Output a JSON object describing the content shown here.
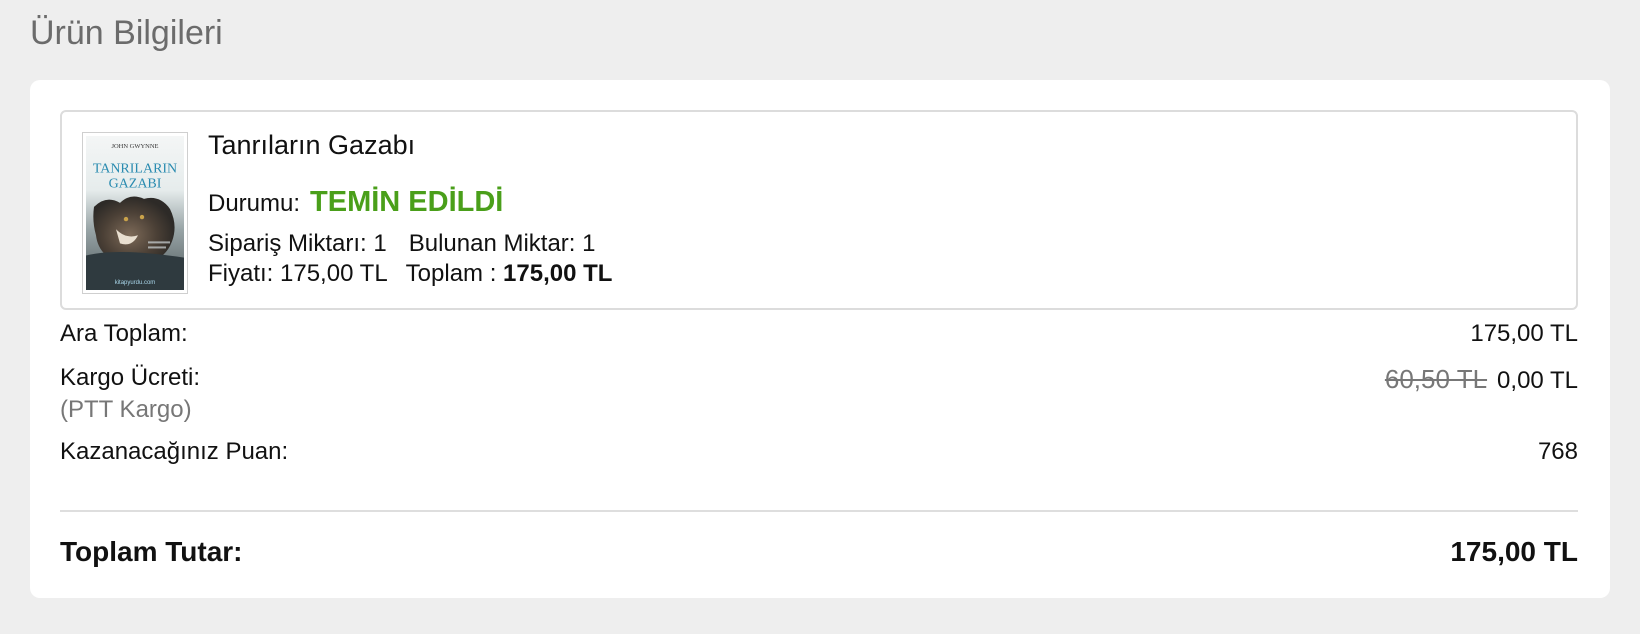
{
  "section_title": "Ürün Bilgileri",
  "product": {
    "name": "Tanrıların Gazabı",
    "cover": {
      "author": "JOHN GWYNNE",
      "title_line1": "TANRILARIN",
      "title_line2": "GAZABI",
      "publisher": "kitapyurdu.com"
    },
    "status_label": "Durumu:",
    "status_value": "TEMİN EDİLDİ",
    "status_color": "#4a9f1a",
    "order_qty_label": "Sipariş Miktarı: 1",
    "found_qty_label": "Bulunan Miktar: 1",
    "price_label": "Fiyatı: 175,00 TL",
    "total_label": "Toplam :",
    "total_value": "175,00 TL"
  },
  "summary": {
    "subtotal_label": "Ara Toplam:",
    "subtotal_value": "175,00 TL",
    "shipping_label": "Kargo Ücreti:",
    "shipping_carrier": "(PTT Kargo)",
    "shipping_old_price": "60,50 TL",
    "shipping_price": "0,00 TL",
    "points_label": "Kazanacağınız Puan:",
    "points_value": "768",
    "grand_total_label": "Toplam Tutar:",
    "grand_total_value": "175,00 TL"
  }
}
